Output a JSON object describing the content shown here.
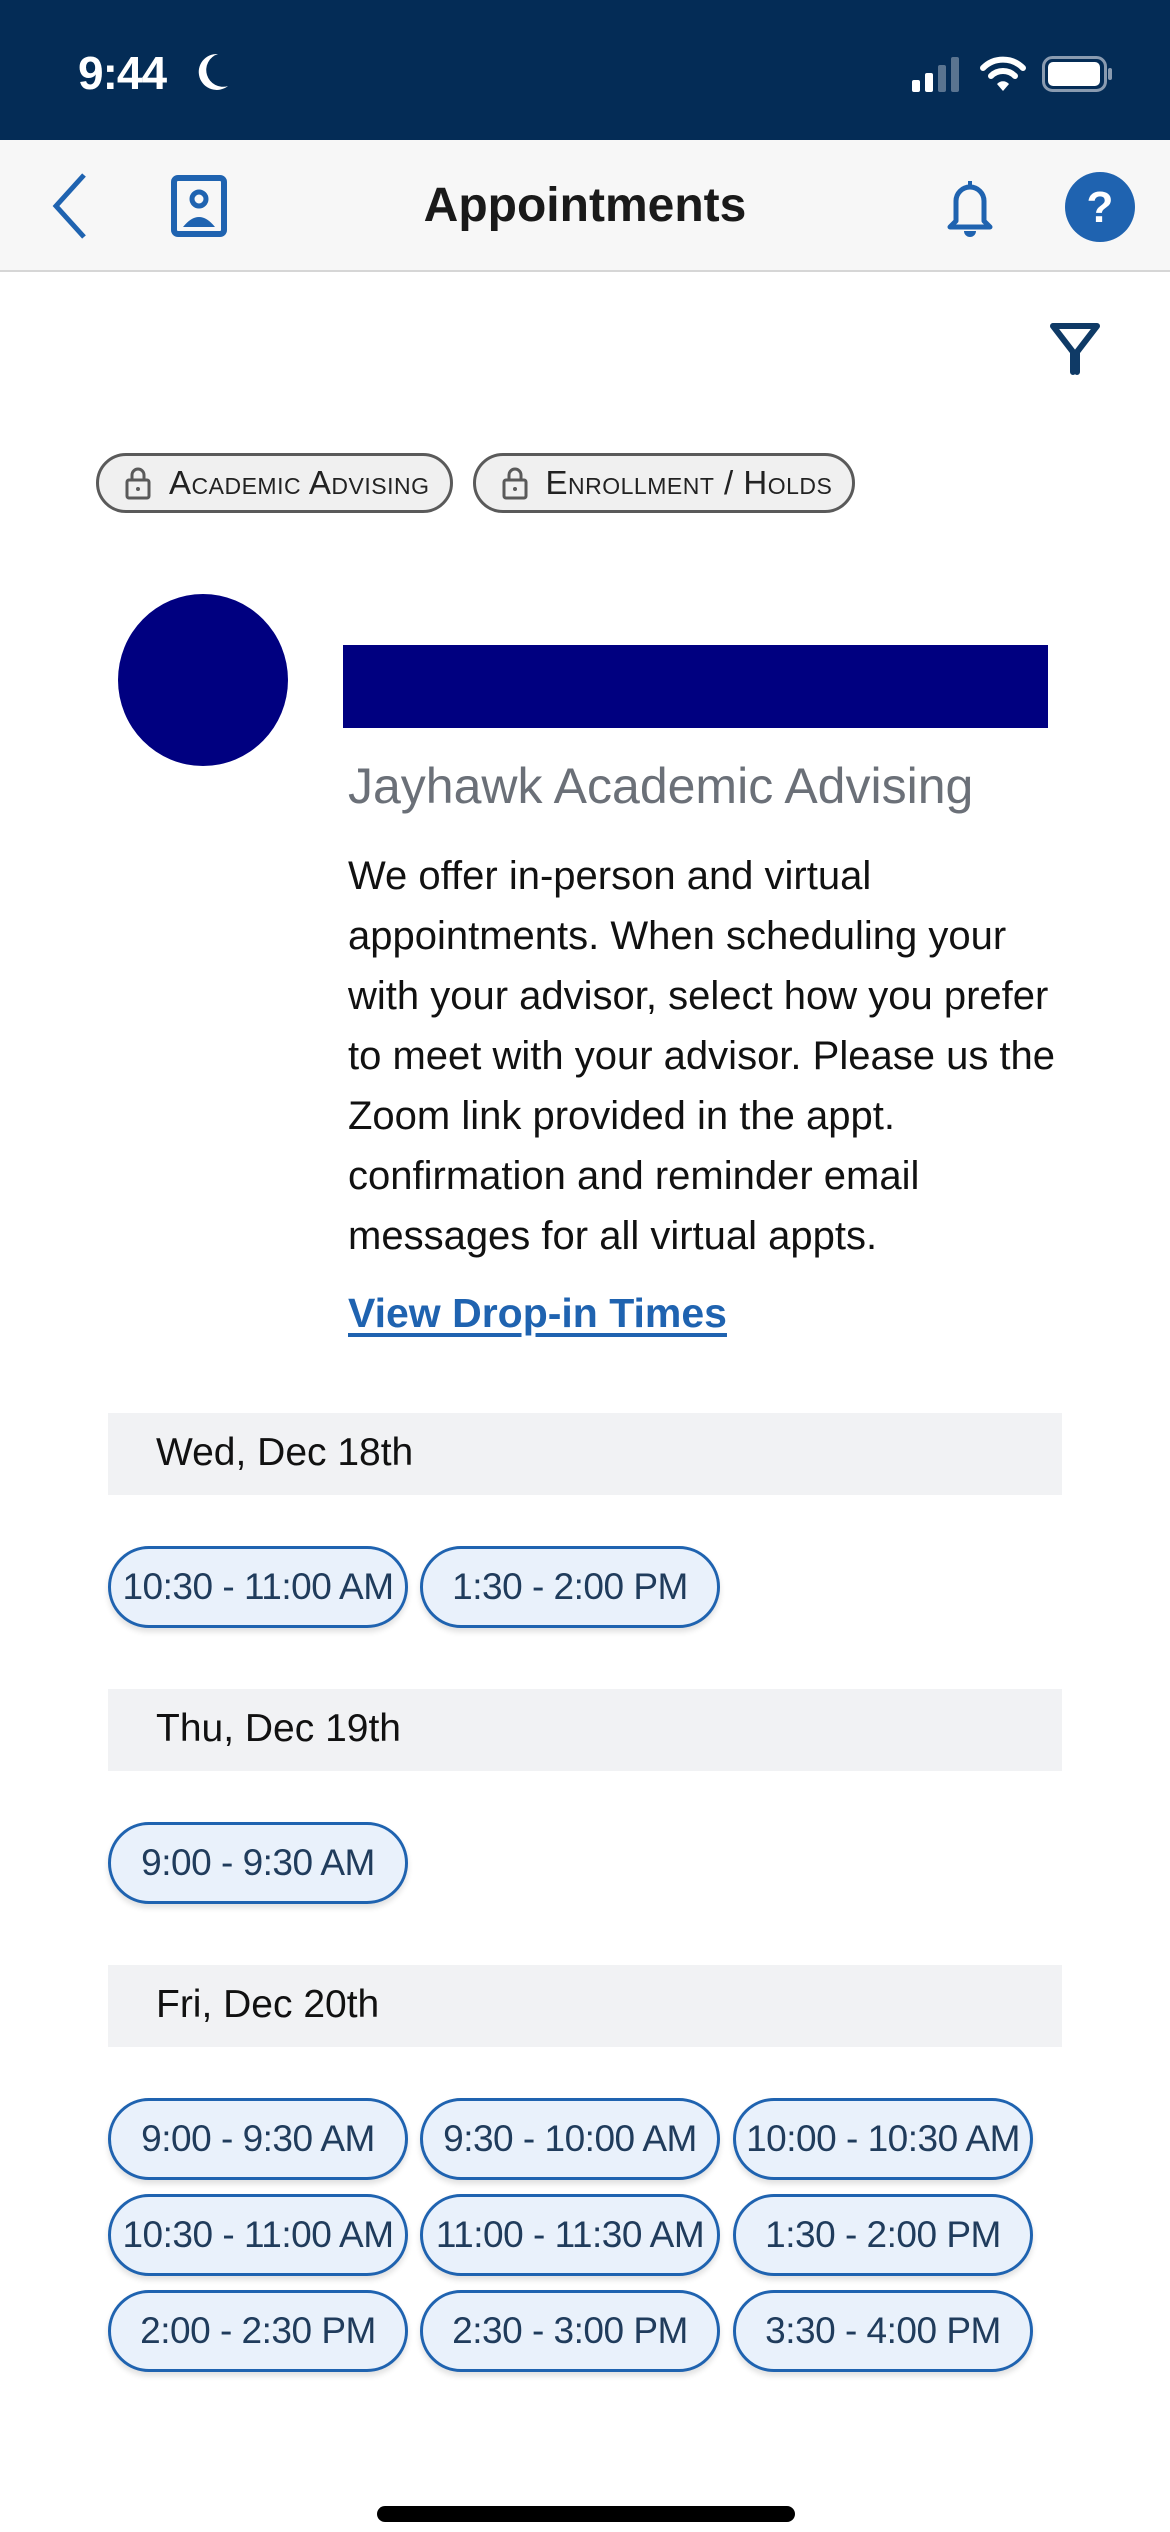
{
  "status_bar": {
    "time": "9:44",
    "focus_icon": "moon-icon",
    "signal_icon": "cellular-signal-icon",
    "wifi_icon": "wifi-icon",
    "battery_icon": "battery-icon"
  },
  "nav": {
    "title": "Appointments",
    "back_icon": "chevron-left-icon",
    "profile_icon": "contact-card-icon",
    "notifications_icon": "bell-icon",
    "help_icon": "question-circle-icon"
  },
  "filter": {
    "icon": "filter-icon"
  },
  "chips": [
    {
      "label": "Academic Advising",
      "icon": "lock-icon"
    },
    {
      "label": "Enrollment / Holds",
      "icon": "lock-icon"
    }
  ],
  "advisor": {
    "org_name": "Jayhawk Academic Advising",
    "description": "We offer in-person and virtual appointments. When scheduling your with your advisor, select how you prefer to meet with your advisor. Please us the Zoom link provided in the appt. confirmation and reminder email messages for all virtual appts.",
    "dropin_link": "View Drop-in Times",
    "colors": {
      "redaction": "#000080"
    }
  },
  "days": [
    {
      "date": "Wed, Dec 18th",
      "slots": [
        "10:30 - 11:00 AM",
        "1:30 - 2:00 PM"
      ]
    },
    {
      "date": "Thu, Dec 19th",
      "slots": [
        "9:00 - 9:30 AM"
      ]
    },
    {
      "date": "Fri, Dec 20th",
      "slots": [
        "9:00 - 9:30 AM",
        "9:30 - 10:00 AM",
        "10:00 - 10:30 AM",
        "10:30 - 11:00 AM",
        "11:00 - 11:30 AM",
        "1:30 - 2:00 PM",
        "2:00 - 2:30 PM",
        "2:30 - 3:00 PM",
        "3:30 - 4:00 PM"
      ]
    }
  ],
  "colors": {
    "status_bar_bg": "#042c56",
    "accent": "#1f63b0",
    "slot_bg": "#e9f1fb",
    "date_header_bg": "#f1f2f4"
  }
}
